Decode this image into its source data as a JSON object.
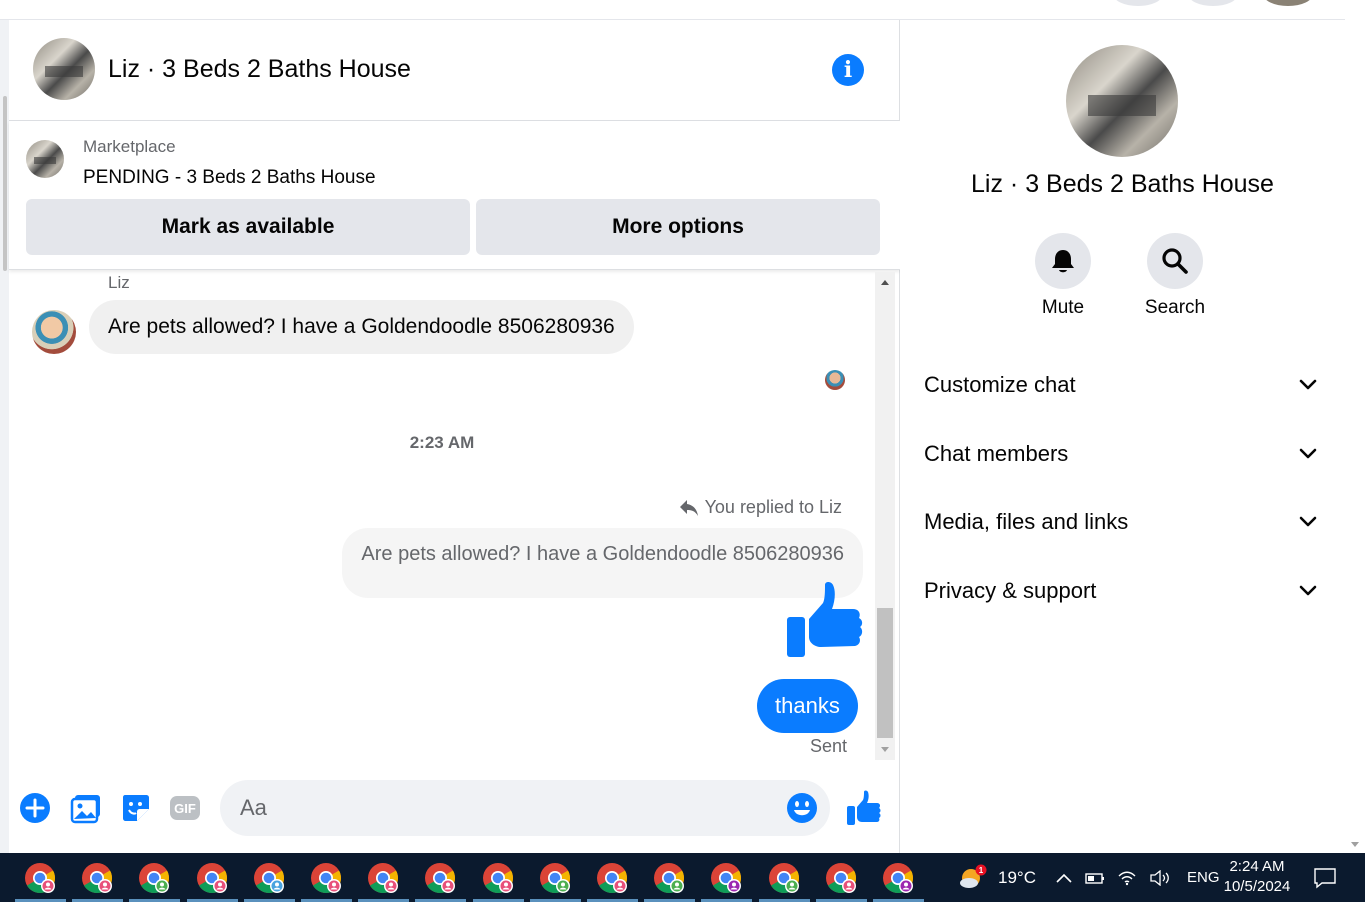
{
  "header": {
    "title": "Liz · 3 Beds 2 Baths House",
    "info_icon": "info-icon"
  },
  "marketplace": {
    "label": "Marketplace",
    "status": "PENDING - 3 Beds 2 Baths House",
    "mark_available": "Mark as available",
    "more_options": "More options"
  },
  "thread": {
    "sender_name": "Liz",
    "incoming_message": "Are pets allowed?  I have a Goldendoodle 8506280936",
    "timestamp": "2:23 AM",
    "replied_to": "You replied to Liz",
    "quoted_message": "Are pets allowed?  I have a Goldendoodle 8506280936",
    "outgoing_message": "thanks",
    "delivery_status": "Sent"
  },
  "composer": {
    "placeholder": "Aa",
    "icons": [
      "plus-circle-icon",
      "photo-icon",
      "sticker-icon",
      "gif-icon",
      "emoji-icon",
      "thumbs-up-icon"
    ]
  },
  "info_panel": {
    "title": "Liz · 3 Beds 2 Baths House",
    "actions": [
      {
        "label": "Mute",
        "icon": "bell-icon"
      },
      {
        "label": "Search",
        "icon": "search-icon"
      }
    ],
    "sections": [
      {
        "label": "Customize chat"
      },
      {
        "label": "Chat members"
      },
      {
        "label": "Media, files and links"
      },
      {
        "label": "Privacy & support"
      }
    ]
  },
  "taskbar": {
    "app_count": 16,
    "weather": "19°C",
    "weather_badge": "1",
    "language": "ENG",
    "time": "2:24 AM",
    "date": "10/5/2024"
  },
  "colors": {
    "accent_blue": "#0a7cff",
    "bubble_gray": "#f0f0f0",
    "button_gray": "#e4e6eb",
    "taskbar": "#0b1a2e"
  }
}
